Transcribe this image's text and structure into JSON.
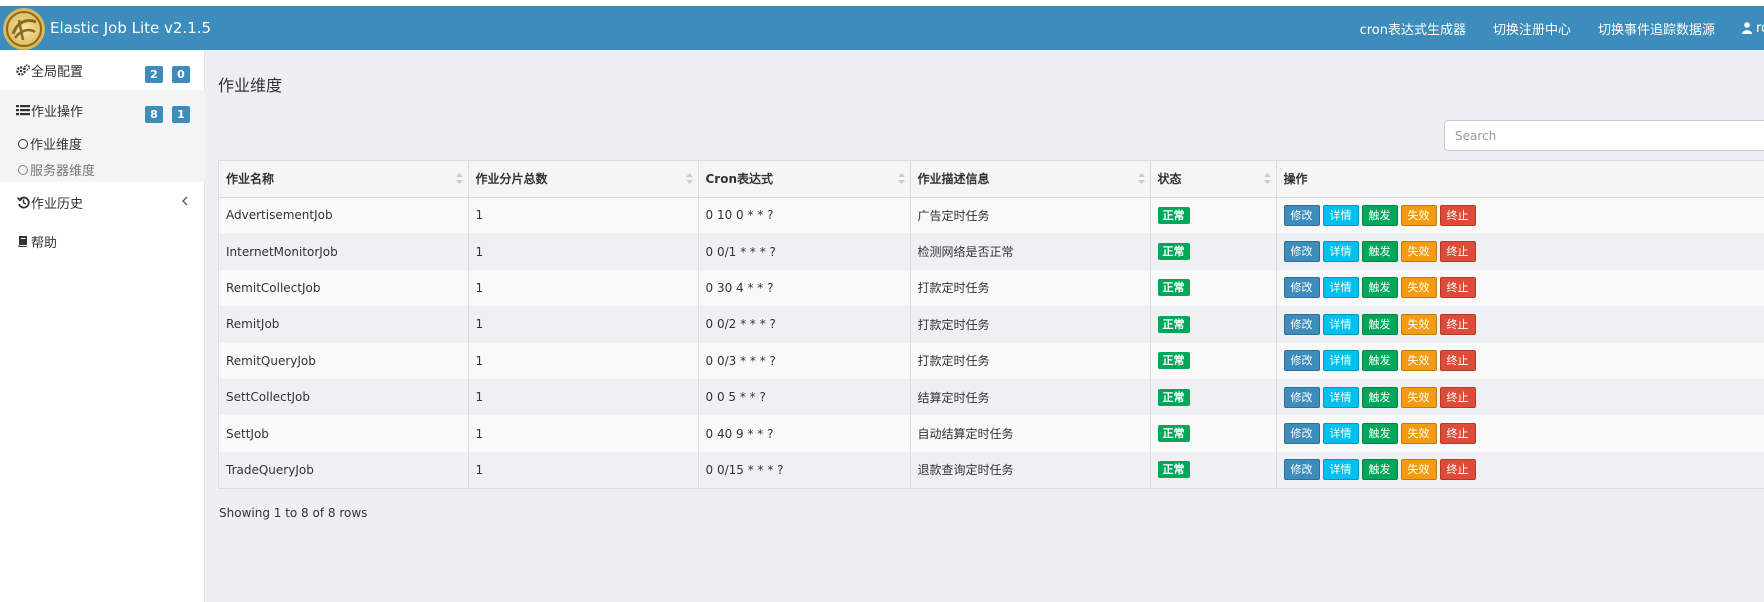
{
  "app": {
    "title": "Elastic Job Lite v2.1.5",
    "nav": [
      "cron表达式生成器",
      "切换注册中心",
      "切换事件追踪数据源"
    ],
    "user_label": "root",
    "accent_color": "#3c8dbc"
  },
  "sidebar": {
    "global_config": {
      "label": "全局配置",
      "badges": [
        "2",
        "0"
      ]
    },
    "job_ops": {
      "label": "作业操作",
      "badges": [
        "8",
        "1"
      ]
    },
    "sub_items": [
      {
        "label": "作业维度",
        "active": true
      },
      {
        "label": "服务器维度",
        "active": false
      }
    ],
    "job_history": {
      "label": "作业历史"
    },
    "help": {
      "label": "帮助"
    }
  },
  "main": {
    "page_title": "作业维度",
    "search_placeholder": "Search",
    "columns": [
      "作业名称",
      "作业分片总数",
      "Cron表达式",
      "作业描述信息",
      "状态",
      "操作"
    ],
    "action_labels": [
      "修改",
      "详情",
      "触发",
      "失效",
      "终止"
    ],
    "rows": [
      {
        "name": "AdvertisementJob",
        "shards": "1",
        "cron": "0 10 0 * * ?",
        "desc": "广告定时任务",
        "status": "正常"
      },
      {
        "name": "InternetMonitorJob",
        "shards": "1",
        "cron": "0 0/1 * * * ?",
        "desc": "检测网络是否正常",
        "status": "正常"
      },
      {
        "name": "RemitCollectJob",
        "shards": "1",
        "cron": "0 30 4 * * ?",
        "desc": "打款定时任务",
        "status": "正常"
      },
      {
        "name": "RemitJob",
        "shards": "1",
        "cron": "0 0/2 * * * ?",
        "desc": "打款定时任务",
        "status": "正常"
      },
      {
        "name": "RemitQueryJob",
        "shards": "1",
        "cron": "0 0/3 * * * ?",
        "desc": "打款定时任务",
        "status": "正常"
      },
      {
        "name": "SettCollectJob",
        "shards": "1",
        "cron": "0 0 5 * * ?",
        "desc": "结算定时任务",
        "status": "正常"
      },
      {
        "name": "SettJob",
        "shards": "1",
        "cron": "0 40 9 * * ?",
        "desc": "自动结算定时任务",
        "status": "正常"
      },
      {
        "name": "TradeQueryJob",
        "shards": "1",
        "cron": "0 0/15 * * * ?",
        "desc": "退款查询定时任务",
        "status": "正常"
      }
    ],
    "footer": "Showing 1 to 8 of 8 rows"
  }
}
